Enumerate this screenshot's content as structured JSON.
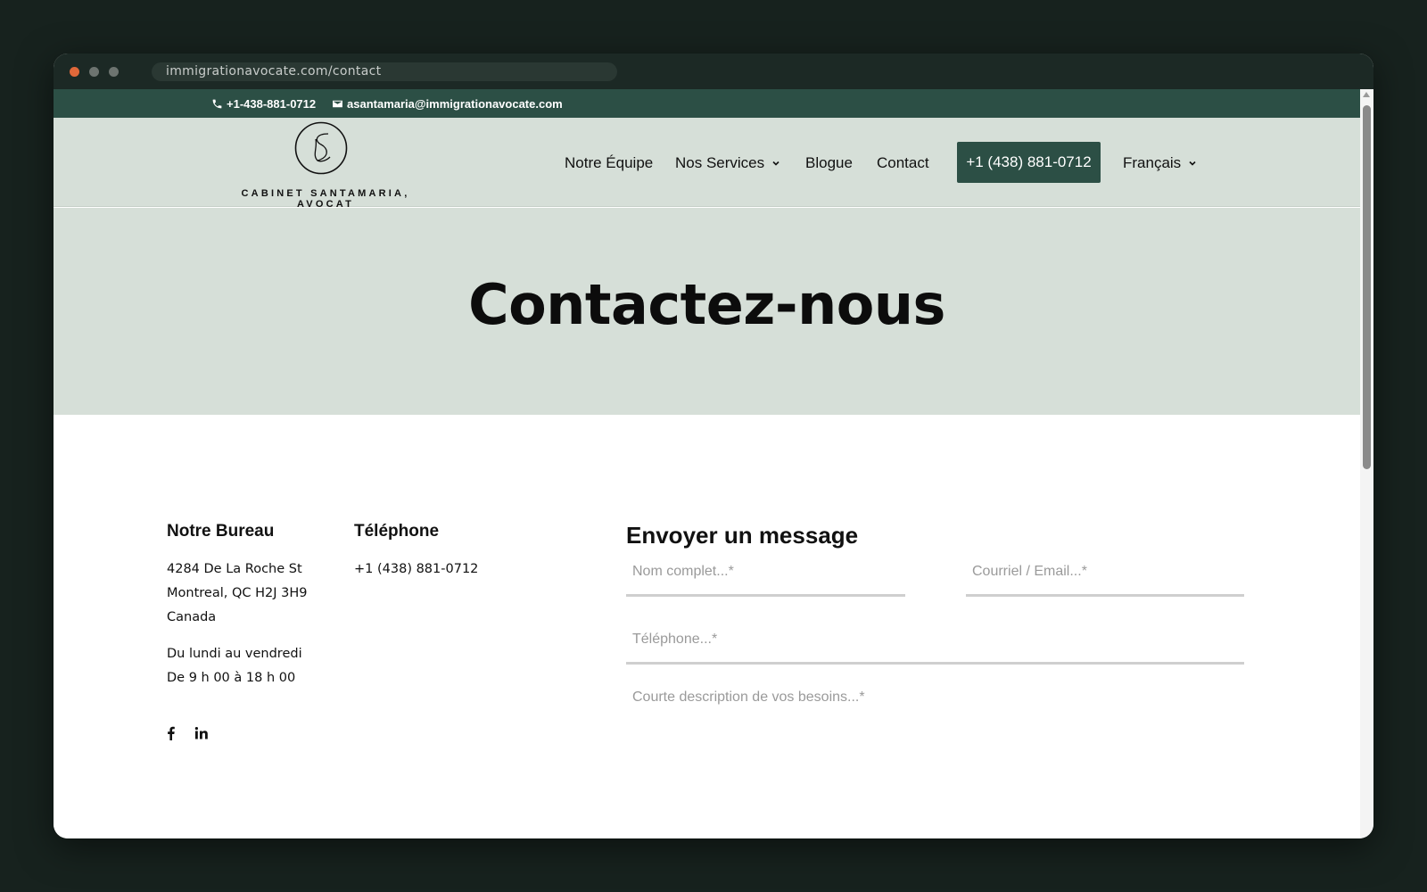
{
  "browser": {
    "url": "immigrationavocate.com/contact"
  },
  "topbar": {
    "phone": "+1-438-881-0712",
    "email": "asantamaria@immigrationavocate.com"
  },
  "header": {
    "logo_text": "CABINET SANTAMARIA, AVOCAT",
    "nav": {
      "team": "Notre Équipe",
      "services": "Nos Services",
      "blog": "Blogue",
      "contact": "Contact",
      "cta_phone": "+1 (438) 881-0712",
      "language": "Français"
    }
  },
  "hero": {
    "title": "Contactez-nous"
  },
  "office": {
    "title": "Notre Bureau",
    "address_line1": "4284 De La Roche St",
    "address_line2": "Montreal, QC H2J 3H9",
    "address_line3": "Canada",
    "hours_line1": "Du lundi au vendredi",
    "hours_line2": "De 9 h 00 à 18 h 00"
  },
  "phone_section": {
    "title": "Téléphone",
    "number": "+1 (438) 881-0712"
  },
  "form": {
    "title": "Envoyer un message",
    "name_placeholder": "Nom complet...*",
    "email_placeholder": "Courriel / Email...*",
    "phone_placeholder": "Téléphone...*",
    "message_placeholder": "Courte description de vos besoins...*"
  },
  "colors": {
    "brand_green": "#2c4f45",
    "header_bg": "#d6dfd8",
    "window_bg": "#17221e"
  },
  "icons": {
    "phone": "phone-icon",
    "email": "envelope-icon",
    "facebook": "facebook-icon",
    "linkedin": "linkedin-icon",
    "chevron": "chevron-down-icon"
  }
}
